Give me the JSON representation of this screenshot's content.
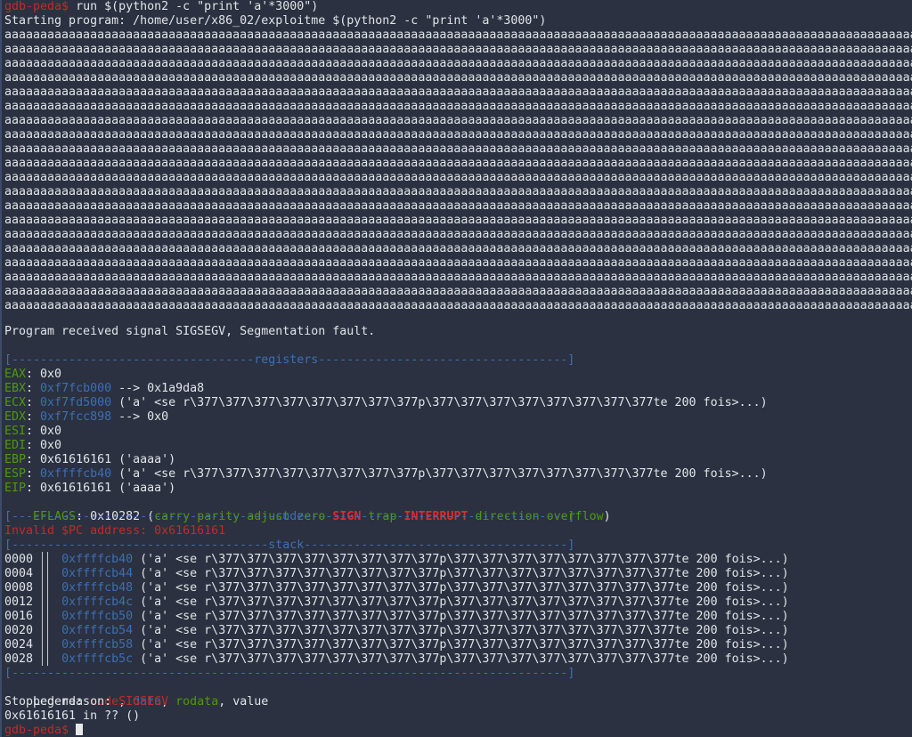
{
  "prompt": "gdb-peda$",
  "command": " run $(python2 -c \"print 'a'*3000\")",
  "starting_program": "Starting program: /home/user/x86_02/exploitme $(python2 -c \"print 'a'*3000\")",
  "overflow_text": "aaaaaaaaaaaaaaaaaaaaaaaaaaaaaaaaaaaaaaaaaaaaaaaaaaaaaaaaaaaaaaaaaaaaaaaaaaaaaaaaaaaaaaaaaaaaaaaaaaaaaaaaaaaaaaaaaaaaaaaaaaaaaaaa",
  "signal_message": "Program received signal SIGSEGV, Segmentation fault.",
  "registers_header": "[----------------------------------registers-----------------------------------]",
  "registers": [
    {
      "name": "EAX",
      "value": "0x0",
      "value_color": "white",
      "rest": ""
    },
    {
      "name": "EBX",
      "value": "0xf7fcb000",
      "value_color": "blue",
      "rest": " --> 0x1a9da8"
    },
    {
      "name": "ECX",
      "value": "0xf7fd5000",
      "value_color": "blue",
      "rest": " ('a' <se r\\377\\377\\377\\377\\377\\377\\377\\377p\\377\\377\\377\\377\\377\\377\\377\\377te 200 fois>...)"
    },
    {
      "name": "EDX",
      "value": "0xf7fcc898",
      "value_color": "blue",
      "rest": " --> 0x0"
    },
    {
      "name": "ESI",
      "value": "0x0",
      "value_color": "white",
      "rest": ""
    },
    {
      "name": "EDI",
      "value": "0x0",
      "value_color": "white",
      "rest": ""
    },
    {
      "name": "EBP",
      "value": "0x61616161",
      "value_color": "white",
      "rest": " ('aaaa')"
    },
    {
      "name": "ESP",
      "value": "0xffffcb40",
      "value_color": "blue",
      "rest": " ('a' <se r\\377\\377\\377\\377\\377\\377\\377\\377p\\377\\377\\377\\377\\377\\377\\377\\377te 200 fois>...)"
    },
    {
      "name": "EIP",
      "value": "0x61616161",
      "value_color": "white",
      "rest": " ('aaaa')"
    }
  ],
  "eflags": {
    "name": "EFLAGS",
    "value": "0x10282",
    "open": " (",
    "flags": [
      {
        "label": "carry",
        "set": false
      },
      {
        "label": "parity",
        "set": false
      },
      {
        "label": "adjust",
        "set": false
      },
      {
        "label": "zero",
        "set": false
      },
      {
        "label": "SIGN",
        "set": true
      },
      {
        "label": "trap",
        "set": false
      },
      {
        "label": "INTERRUPT",
        "set": true
      },
      {
        "label": "direction",
        "set": false
      },
      {
        "label": "overflow",
        "set": false
      }
    ],
    "close": ")"
  },
  "code_header": "[-------------------------------------code-------------------------------------]",
  "invalid_pc": "Invalid $PC address: 0x61616161",
  "stack_header": "[------------------------------------stack-------------------------------------]",
  "stack": [
    {
      "offset": "0000",
      "addr": "0xffffcb40",
      "content": " ('a' <se r\\377\\377\\377\\377\\377\\377\\377\\377p\\377\\377\\377\\377\\377\\377\\377\\377te 200 fois>...)"
    },
    {
      "offset": "0004",
      "addr": "0xffffcb44",
      "content": " ('a' <se r\\377\\377\\377\\377\\377\\377\\377\\377p\\377\\377\\377\\377\\377\\377\\377\\377te 200 fois>...)"
    },
    {
      "offset": "0008",
      "addr": "0xffffcb48",
      "content": " ('a' <se r\\377\\377\\377\\377\\377\\377\\377\\377p\\377\\377\\377\\377\\377\\377\\377\\377te 200 fois>...)"
    },
    {
      "offset": "0012",
      "addr": "0xffffcb4c",
      "content": " ('a' <se r\\377\\377\\377\\377\\377\\377\\377\\377p\\377\\377\\377\\377\\377\\377\\377\\377te 200 fois>...)"
    },
    {
      "offset": "0016",
      "addr": "0xffffcb50",
      "content": " ('a' <se r\\377\\377\\377\\377\\377\\377\\377\\377p\\377\\377\\377\\377\\377\\377\\377\\377te 200 fois>...)"
    },
    {
      "offset": "0020",
      "addr": "0xffffcb54",
      "content": " ('a' <se r\\377\\377\\377\\377\\377\\377\\377\\377p\\377\\377\\377\\377\\377\\377\\377\\377te 200 fois>...)"
    },
    {
      "offset": "0024",
      "addr": "0xffffcb58",
      "content": " ('a' <se r\\377\\377\\377\\377\\377\\377\\377\\377p\\377\\377\\377\\377\\377\\377\\377\\377te 200 fois>...)"
    },
    {
      "offset": "0028",
      "addr": "0xffffcb5c",
      "content": " ('a' <se r\\377\\377\\377\\377\\377\\377\\377\\377p\\377\\377\\377\\377\\377\\377\\377\\377te 200 fois>...)"
    }
  ],
  "bottom_header": "[------------------------------------------------------------------------------]",
  "legend": {
    "label": "Legend: ",
    "code": "code",
    "sep1": ", ",
    "data": "data",
    "sep2": ", ",
    "rodata": "rodata",
    "sep3": ", value"
  },
  "stopped_label": "Stopped reason: ",
  "stopped_reason": "SIGSEGV",
  "frame_line": "0x61616161 in ?? ()",
  "colors": {
    "background": "#2b3140",
    "prompt_red": "#c32a2a",
    "register_green": "#4e9a06",
    "address_blue": "#3b6fb6",
    "flag_set_red": "#e02a2a",
    "text": "#e1e4e8"
  }
}
